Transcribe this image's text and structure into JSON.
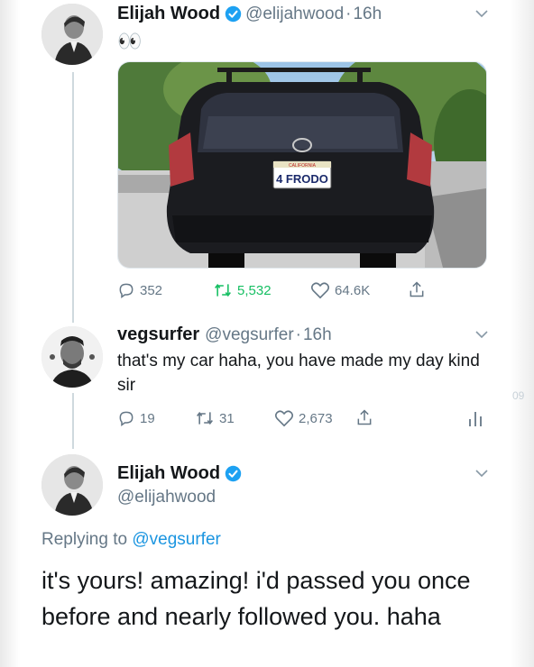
{
  "tweet1": {
    "name": "Elijah Wood",
    "handle": "@elijahwood",
    "time": "16h",
    "text": "👀",
    "media": {
      "plate_text": "4 FRODO",
      "plate_state": "CALIFORNIA"
    },
    "stats": {
      "replies": "352",
      "retweets": "5,532",
      "likes": "64.6K"
    },
    "colors": {
      "retweet": "#17bf63",
      "text_secondary": "#657786"
    }
  },
  "tweet2": {
    "name": "vegsurfer",
    "handle": "@vegsurfer",
    "time": "16h",
    "text": "that's my car haha, you have made my day kind sir",
    "stats": {
      "replies": "19",
      "retweets": "31",
      "likes": "2,673"
    }
  },
  "tweet3": {
    "name": "Elijah Wood",
    "handle": "@elijahwood",
    "replying_label": "Replying to",
    "replying_handle": "@vegsurfer",
    "text": "it's yours! amazing! i'd passed you once before and nearly followed you. haha"
  },
  "edge_text": "09",
  "colors": {
    "verified": "#1da1f2",
    "link": "#1b95e0",
    "thread": "#cfd9de"
  }
}
